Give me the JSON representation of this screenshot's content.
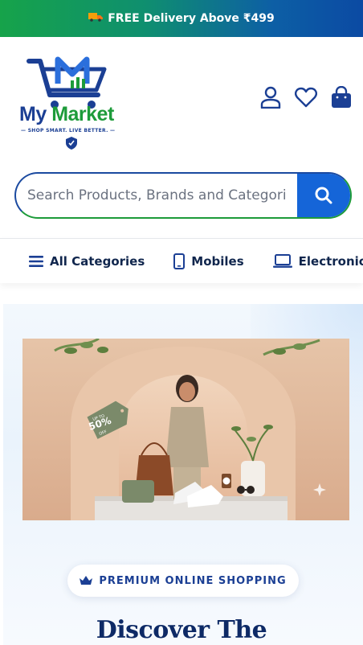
{
  "promo": {
    "text": "FREE Delivery Above ₹499",
    "icon": "truck-icon"
  },
  "logo": {
    "brand_my": "My",
    "brand_market": "Market",
    "tagline": "— SHOP SMART. LIVE BETTER. —"
  },
  "header_icons": [
    "user-icon",
    "heart-icon",
    "shopping-bag-icon"
  ],
  "search": {
    "placeholder": "Search Products, Brands and Categories"
  },
  "categories": [
    {
      "label": "All Categories",
      "icon": "menu-icon"
    },
    {
      "label": "Mobiles",
      "icon": "mobile-icon"
    },
    {
      "label": "Electronics",
      "icon": "laptop-icon"
    }
  ],
  "banner": {
    "discount_top": "UP TO",
    "discount_value": "50%",
    "discount_bottom": "OFF"
  },
  "hero": {
    "pill_text": "PREMIUM ONLINE SHOPPING",
    "heading": "Discover The"
  },
  "colors": {
    "accent_blue": "#1565d8",
    "brand_green": "#1d9b3a",
    "navy": "#10264d"
  }
}
